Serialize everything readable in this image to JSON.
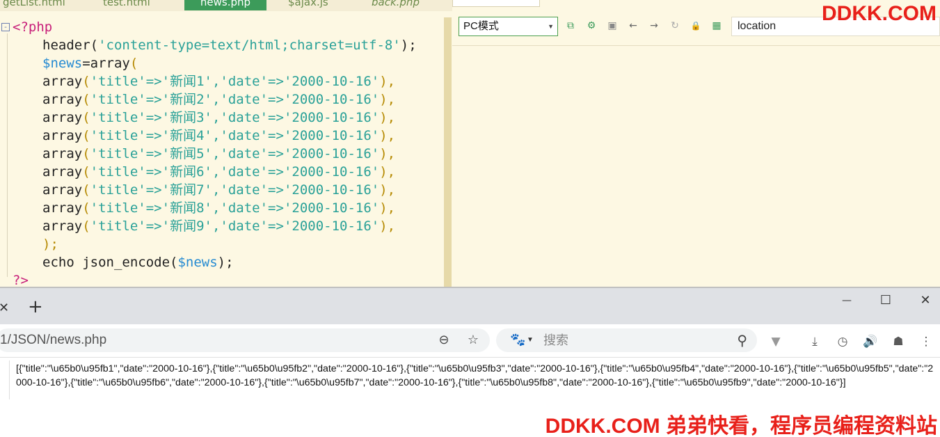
{
  "editor": {
    "tabs": [
      {
        "label": "getList.html",
        "active": false
      },
      {
        "label": "test.html",
        "active": false
      },
      {
        "label": "news.php",
        "active": true
      },
      {
        "label": "$ajax.js",
        "active": false
      },
      {
        "label": "back.php",
        "active": false
      }
    ],
    "fold_marker": "-",
    "code": {
      "open_tag": "<?php",
      "line_header": "header(",
      "header_str": "'content-type=text/html;charset=utf-8'",
      "header_end": ");",
      "news_var": "$news",
      "assign": "=array",
      "open_paren": "(",
      "items": [
        {
          "title": "'新闻1'",
          "date": "'2000-10-16'"
        },
        {
          "title": "'新闻2'",
          "date": "'2000-10-16'"
        },
        {
          "title": "'新闻3'",
          "date": "'2000-10-16'"
        },
        {
          "title": "'新闻4'",
          "date": "'2000-10-16'"
        },
        {
          "title": "'新闻5'",
          "date": "'2000-10-16'"
        },
        {
          "title": "'新闻6'",
          "date": "'2000-10-16'"
        },
        {
          "title": "'新闻7'",
          "date": "'2000-10-16'"
        },
        {
          "title": "'新闻8'",
          "date": "'2000-10-16'"
        },
        {
          "title": "'新闻9'",
          "date": "'2000-10-16'"
        }
      ],
      "array_kw": "array",
      "key_title": "'title'",
      "key_date": "'date'",
      "arrow": "=>",
      "comma": ",",
      "close_array": ");",
      "echo_kw": "echo json_encode(",
      "echo_var": "$news",
      "echo_end": ");",
      "close_tag": "?>"
    }
  },
  "preview": {
    "mode_select": "PC模式",
    "location_placeholder": "location",
    "watermark": "DDKK.COM",
    "toolbar_icons": [
      "open-external-icon",
      "settings-icon",
      "console-icon",
      "back-icon",
      "forward-icon",
      "refresh-icon",
      "lock-icon",
      "qr-code-icon"
    ]
  },
  "browser": {
    "tab_close": "✕",
    "new_tab": "+",
    "window": {
      "minimize": "—",
      "maximize": "☐",
      "close": "✕"
    },
    "address": "1/JSON/news.php",
    "search_placeholder": "搜索",
    "json_output": "[{\"title\":\"\\u65b0\\u95fb1\",\"date\":\"2000-10-16\"},{\"title\":\"\\u65b0\\u95fb2\",\"date\":\"2000-10-16\"},{\"title\":\"\\u65b0\\u95fb3\",\"date\":\"2000-10-16\"},{\"title\":\"\\u65b0\\u95fb4\",\"date\":\"2000-10-16\"},{\"title\":\"\\u65b0\\u95fb5\",\"date\":\"2000-10-16\"},{\"title\":\"\\u65b0\\u95fb6\",\"date\":\"2000-10-16\"},{\"title\":\"\\u65b0\\u95fb7\",\"date\":\"2000-10-16\"},{\"title\":\"\\u65b0\\u95fb8\",\"date\":\"2000-10-16\"},{\"title\":\"\\u65b0\\u95fb9\",\"date\":\"2000-10-16\"}]",
    "watermark": "DDKK.COM 弟弟快看，程序员编程资料站"
  }
}
